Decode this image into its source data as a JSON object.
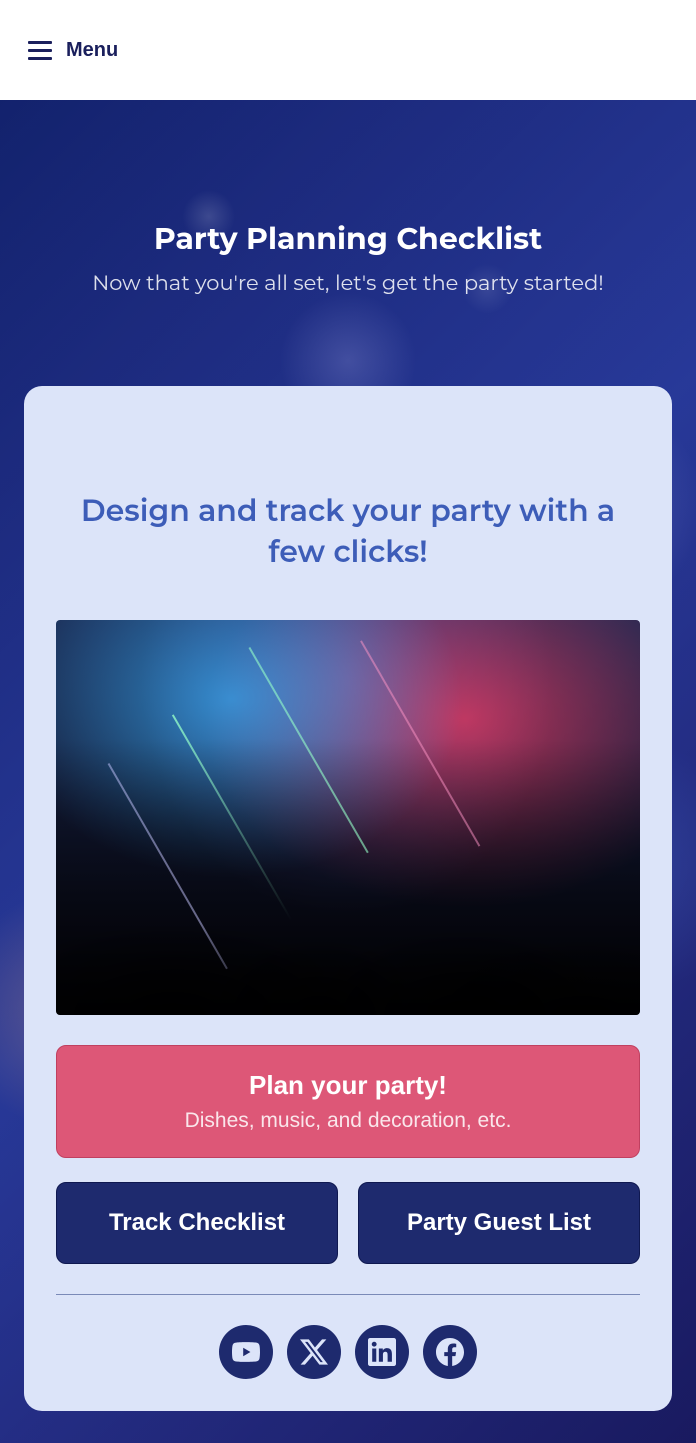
{
  "header": {
    "menu_label": "Menu"
  },
  "hero": {
    "title": "Party Planning Checklist",
    "subtitle": "Now that you're all set, let's get the party started!"
  },
  "card": {
    "heading": "Design and track your party with a few clicks!",
    "primary_button": {
      "title": "Plan your party!",
      "subtitle": "Dishes, music, and decoration, etc."
    },
    "secondary_buttons": {
      "track": "Track Checklist",
      "guest": "Party Guest List"
    }
  },
  "social": {
    "youtube": "youtube-icon",
    "x_twitter": "x-twitter-icon",
    "linkedin": "linkedin-icon",
    "facebook": "facebook-icon"
  },
  "colors": {
    "primary_pink": "#dd5777",
    "primary_navy": "#1e2a6e",
    "card_bg": "#dce4f9",
    "heading_blue": "#3d5db8"
  }
}
